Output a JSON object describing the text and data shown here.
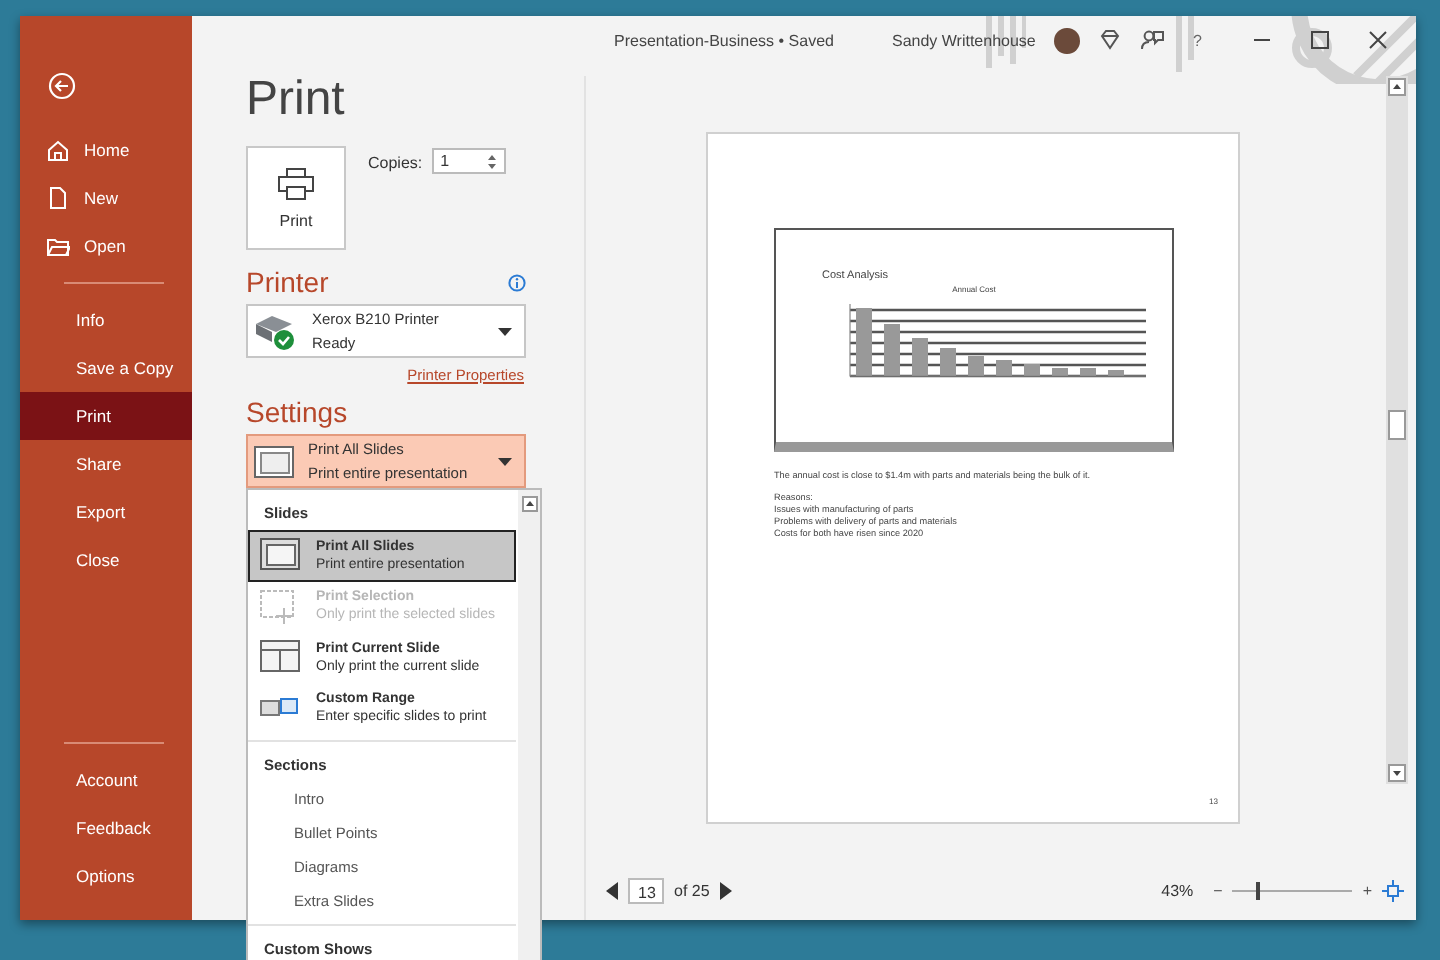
{
  "window": {
    "title": "Presentation-Business • Saved",
    "user": "Sandy Writtenhouse",
    "help": "?"
  },
  "sidebar": {
    "top_items": [
      {
        "label": "Home",
        "kind": "home"
      },
      {
        "label": "New",
        "kind": "new"
      },
      {
        "label": "Open",
        "kind": "open"
      }
    ],
    "middle_items": [
      {
        "label": "Info",
        "selected": false
      },
      {
        "label": "Save a Copy",
        "selected": false
      },
      {
        "label": "Print",
        "selected": true
      },
      {
        "label": "Share",
        "selected": false
      },
      {
        "label": "Export",
        "selected": false
      },
      {
        "label": "Close",
        "selected": false
      }
    ],
    "bottom_items": [
      {
        "label": "Account"
      },
      {
        "label": "Feedback"
      },
      {
        "label": "Options"
      }
    ]
  },
  "print_panel": {
    "title": "Print",
    "print_button": "Print",
    "copies_label": "Copies:",
    "copies_value": "1",
    "printer_heading": "Printer",
    "printer": {
      "name": "Xerox B210 Printer",
      "status": "Ready"
    },
    "printer_properties": "Printer Properties",
    "settings_heading": "Settings",
    "settings_dropdown": {
      "title": "Print All Slides",
      "subtitle": "Print entire presentation",
      "expanded": true
    }
  },
  "dropdown_menu": {
    "sections": [
      {
        "heading": "Slides",
        "items": [
          {
            "kind": "all",
            "title": "Print All Slides",
            "subtitle": "Print entire presentation",
            "selected": true,
            "disabled": false
          },
          {
            "kind": "selection",
            "title": "Print Selection",
            "subtitle": "Only print the selected slides",
            "selected": false,
            "disabled": true
          },
          {
            "kind": "current",
            "title": "Print Current Slide",
            "subtitle": "Only print the current slide",
            "selected": false,
            "disabled": false
          },
          {
            "kind": "range",
            "title": "Custom Range",
            "subtitle": "Enter specific slides to print",
            "selected": false,
            "disabled": false
          }
        ]
      },
      {
        "heading": "Sections",
        "items": [
          {
            "kind": "plain",
            "title": "Intro"
          },
          {
            "kind": "plain",
            "title": "Bullet Points"
          },
          {
            "kind": "plain",
            "title": "Diagrams"
          },
          {
            "kind": "plain",
            "title": "Extra Slides"
          }
        ]
      },
      {
        "heading": "Custom Shows"
      }
    ]
  },
  "preview": {
    "slide_title": "Cost Analysis",
    "chart_title": "Annual Cost",
    "body": "The annual cost is close to $1.4m with parts and materials being the bulk of it.",
    "notes": [
      "Reasons:",
      "Issues with manufacturing of parts",
      "Problems with delivery of parts and materials",
      "Costs for both have risen since 2020"
    ],
    "page_number": "13"
  },
  "status_bar": {
    "page": "13",
    "of": "of 25",
    "zoom": "43%",
    "zoom_out": "−",
    "zoom_in": "+",
    "zoom_slider": {
      "level": 0.2
    }
  }
}
